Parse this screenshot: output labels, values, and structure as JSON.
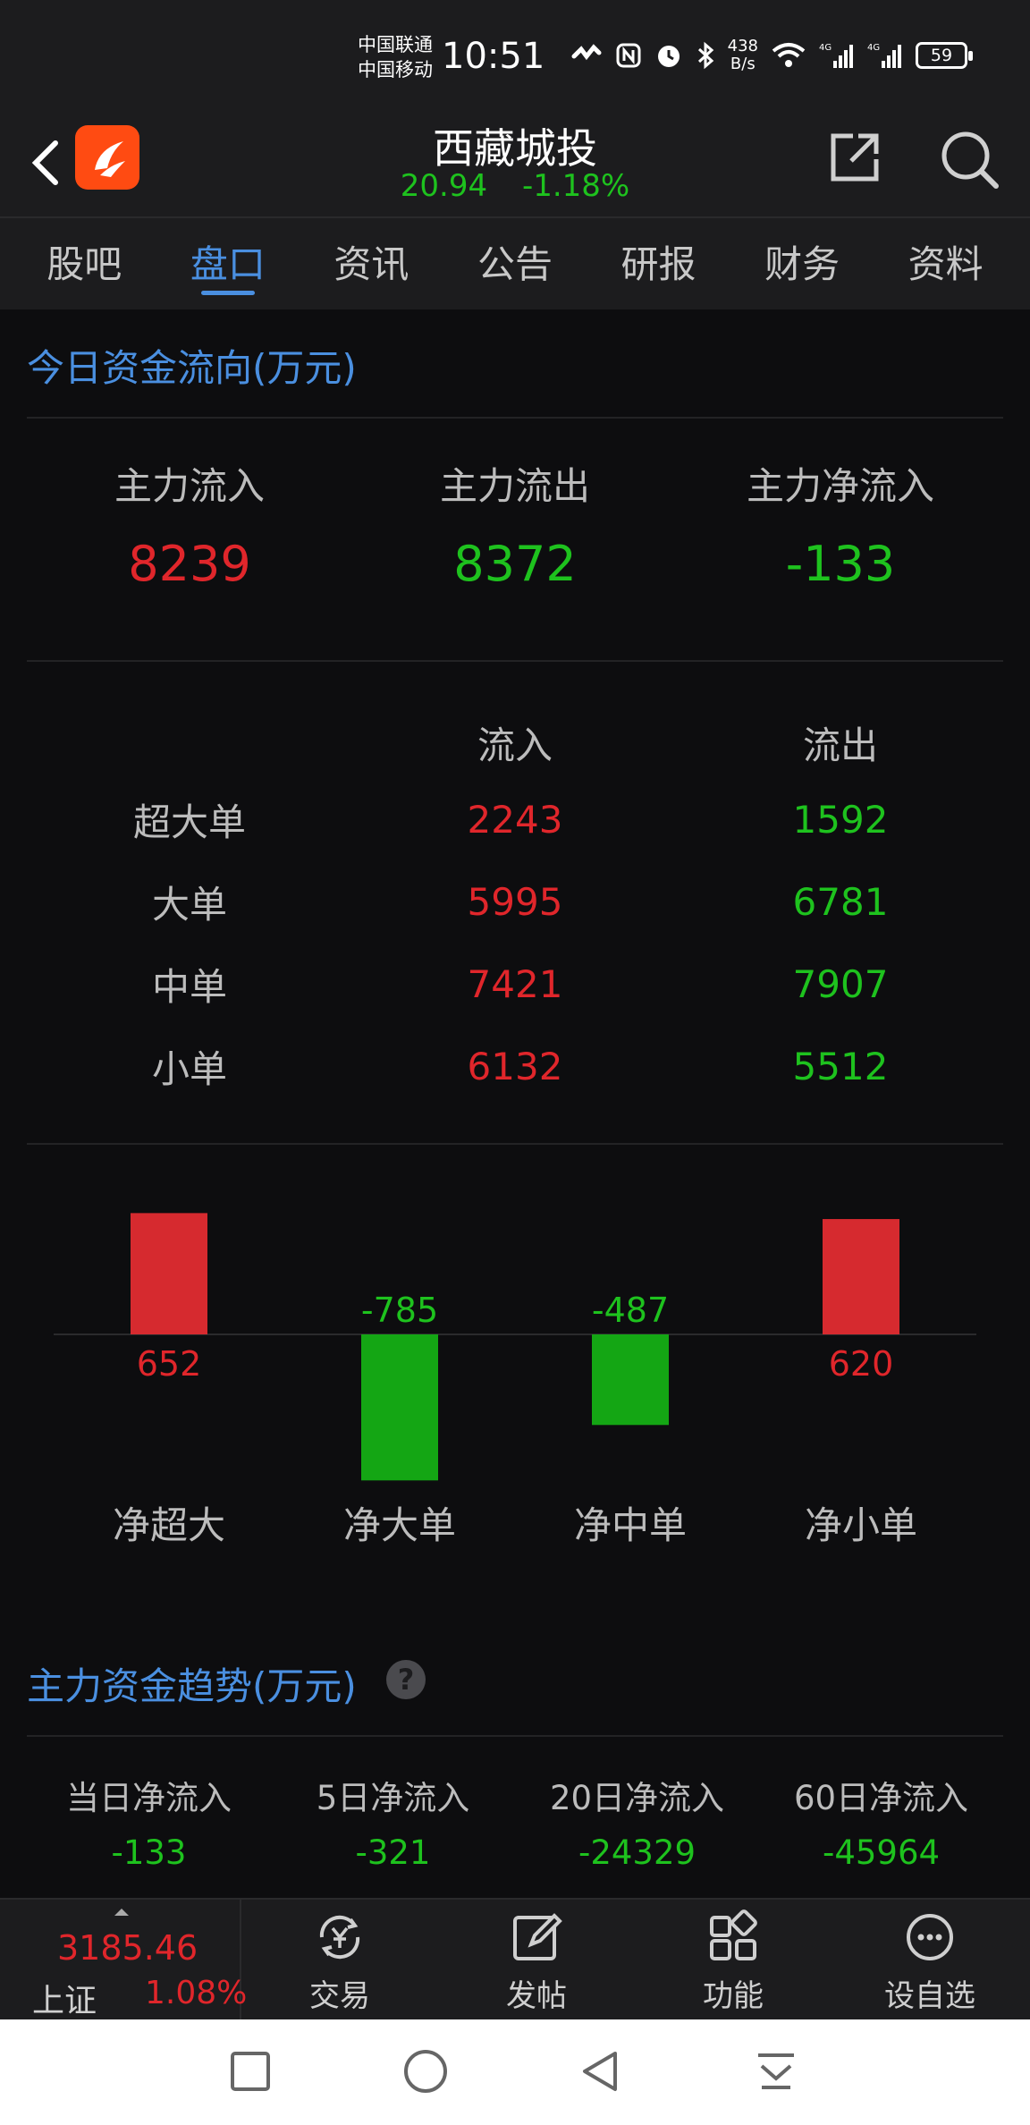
{
  "status_bar": {
    "carrier1": "中国联通",
    "carrier2": "中国移动",
    "time": "10:51",
    "net_rate_value": "438",
    "net_rate_unit": "B/s",
    "battery": "59"
  },
  "header": {
    "stock_name": "西藏城投",
    "price": "20.94",
    "change_pct": "-1.18%"
  },
  "tabs": [
    {
      "label": "股吧"
    },
    {
      "label": "盘口",
      "active": true
    },
    {
      "label": "资讯"
    },
    {
      "label": "公告"
    },
    {
      "label": "研报"
    },
    {
      "label": "财务"
    },
    {
      "label": "资料"
    }
  ],
  "fund_flow": {
    "title": "今日资金流向(万元)",
    "summary": [
      {
        "label": "主力流入",
        "value": "8239"
      },
      {
        "label": "主力流出",
        "value": "8372"
      },
      {
        "label": "主力净流入",
        "value": "-133"
      }
    ],
    "table": {
      "headers": [
        "",
        "流入",
        "流出"
      ],
      "rows": [
        {
          "label": "超大单",
          "inflow": "2243",
          "outflow": "1592"
        },
        {
          "label": "大单",
          "inflow": "5995",
          "outflow": "6781"
        },
        {
          "label": "中单",
          "inflow": "7421",
          "outflow": "7907"
        },
        {
          "label": "小单",
          "inflow": "6132",
          "outflow": "5512"
        }
      ]
    }
  },
  "chart_data": {
    "type": "bar",
    "categories": [
      "净超大",
      "净大单",
      "净中单",
      "净小单"
    ],
    "values": [
      652,
      -785,
      -487,
      620
    ],
    "data_labels": [
      "652",
      "-785",
      "-487",
      "620"
    ],
    "colors": {
      "positive": "#d62a2f",
      "negative": "#14a614"
    },
    "grid": false,
    "legend": "none"
  },
  "trend": {
    "title": "主力资金趋势(万元)",
    "help": "?",
    "items": [
      {
        "label": "当日净流入",
        "value": "-133"
      },
      {
        "label": "5日净流入",
        "value": "-321"
      },
      {
        "label": "20日净流入",
        "value": "-24329"
      },
      {
        "label": "60日净流入",
        "value": "-45964"
      }
    ]
  },
  "bottom_nav": {
    "index_value": "3185.46",
    "index_name": "上证",
    "index_change": "1.08%",
    "items": [
      {
        "label": "交易",
        "icon": "yuan-exchange-icon"
      },
      {
        "label": "发帖",
        "icon": "edit-icon"
      },
      {
        "label": "功能",
        "icon": "grid-icon"
      },
      {
        "label": "设自选",
        "icon": "more-icon"
      }
    ]
  }
}
